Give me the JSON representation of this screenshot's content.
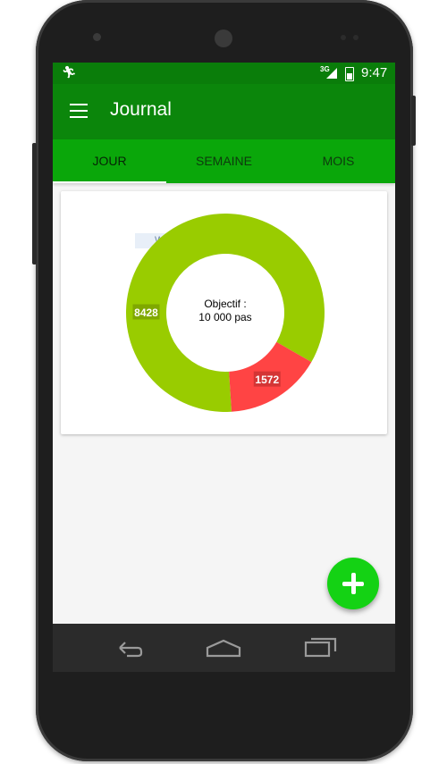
{
  "status_bar": {
    "network": "3G",
    "time": "9:47"
  },
  "app_bar": {
    "title": "Journal"
  },
  "tabs": [
    {
      "label": "JOUR",
      "active": true
    },
    {
      "label": "SEMAINE",
      "active": false
    },
    {
      "label": "MOIS",
      "active": false
    }
  ],
  "overlay": {
    "snip_label": "Window Snip"
  },
  "chart_data": {
    "type": "pie",
    "style": "donut",
    "center_label_line1": "Objectif :",
    "center_label_line2": "10 000 pas",
    "slices": [
      {
        "label": "8428",
        "value": 8428,
        "color": "#99cc00"
      },
      {
        "label": "1572",
        "value": 1572,
        "color": "#ff4444"
      }
    ]
  },
  "colors": {
    "status_bar": "#0a7d0a",
    "app_bar": "#0b860b",
    "tabs": "#0aa70a",
    "fab": "#14d214"
  },
  "icons": {
    "menu": "hamburger-menu-icon",
    "fab": "plus-icon",
    "nav_back": "back-arrow-icon",
    "nav_home": "home-icon",
    "nav_recents": "recent-apps-icon"
  }
}
